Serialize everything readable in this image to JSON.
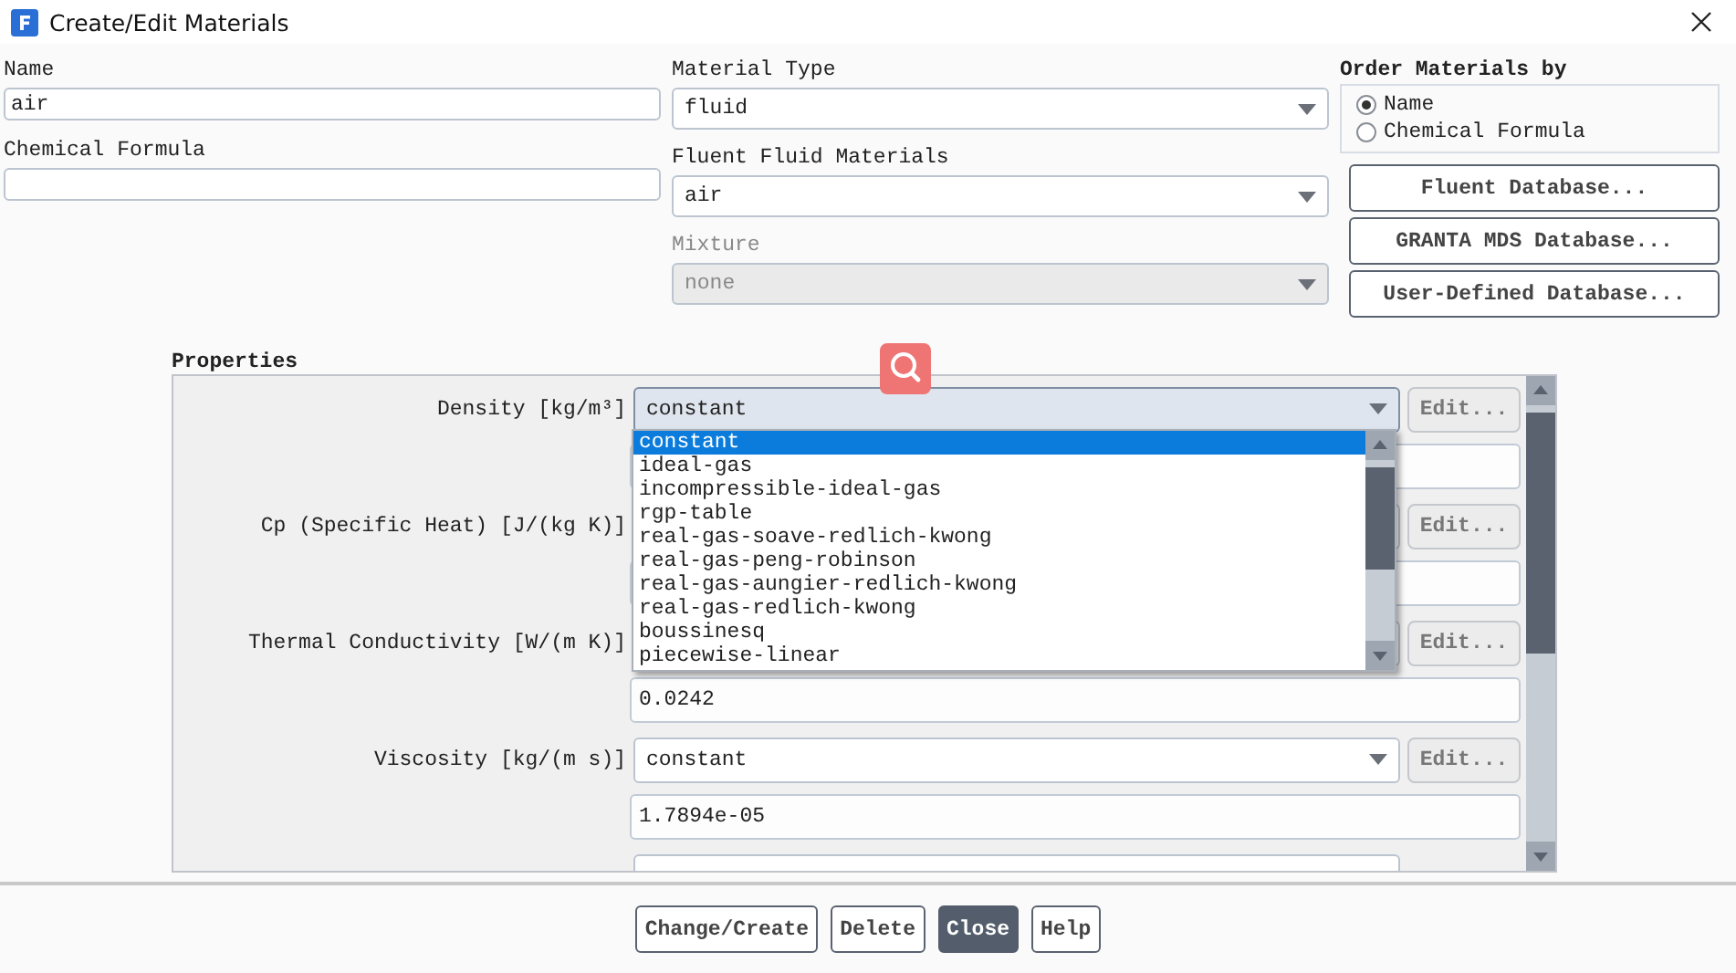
{
  "window": {
    "title": "Create/Edit Materials"
  },
  "name": {
    "label": "Name",
    "value": "air"
  },
  "chemical_formula": {
    "label": "Chemical Formula"
  },
  "material_type": {
    "label": "Material Type",
    "value": "fluid",
    "disabled": false
  },
  "fluent_fluid_materials": {
    "label": "Fluent Fluid Materials",
    "value": "air",
    "disabled": false
  },
  "mixture": {
    "label": "Mixture",
    "value": "none",
    "disabled": true
  },
  "order_materials_by": {
    "label": "Order Materials by",
    "options": [
      {
        "label": "Name",
        "selected": true
      },
      {
        "label": "Chemical Formula",
        "selected": false
      }
    ]
  },
  "database_buttons": [
    "Fluent Database...",
    "GRANTA MDS Database...",
    "User-Defined Database..."
  ],
  "properties": {
    "title": "Properties",
    "rows": [
      {
        "label": "Density [kg/m³]",
        "method": "constant",
        "edit": "Edit...",
        "open": true,
        "options": [
          {
            "label": "constant",
            "selected": true
          },
          {
            "label": "ideal-gas",
            "selected": false
          },
          {
            "label": "incompressible-ideal-gas",
            "selected": false
          },
          {
            "label": "rgp-table",
            "selected": false
          },
          {
            "label": "real-gas-soave-redlich-kwong",
            "selected": false
          },
          {
            "label": "real-gas-peng-robinson",
            "selected": false
          },
          {
            "label": "real-gas-aungier-redlich-kwong",
            "selected": false
          },
          {
            "label": "real-gas-redlich-kwong",
            "selected": false
          },
          {
            "label": "boussinesq",
            "selected": false
          },
          {
            "label": "piecewise-linear",
            "selected": false
          }
        ]
      },
      {
        "label": "Cp (Specific Heat) [J/(kg K)]",
        "edit": "Edit...",
        "open": false
      },
      {
        "label": "Thermal Conductivity [W/(m K)]",
        "edit": "Edit...",
        "value": "0.0242",
        "open": false
      },
      {
        "label": "Viscosity [kg/(m s)]",
        "method": "constant",
        "edit": "Edit...",
        "value": "1.7894e-05",
        "open": false
      }
    ]
  },
  "buttons": [
    {
      "label": "Change/Create",
      "primary": false
    },
    {
      "label": "Delete",
      "primary": false
    },
    {
      "label": "Close",
      "primary": true
    },
    {
      "label": "Help",
      "primary": false
    }
  ]
}
